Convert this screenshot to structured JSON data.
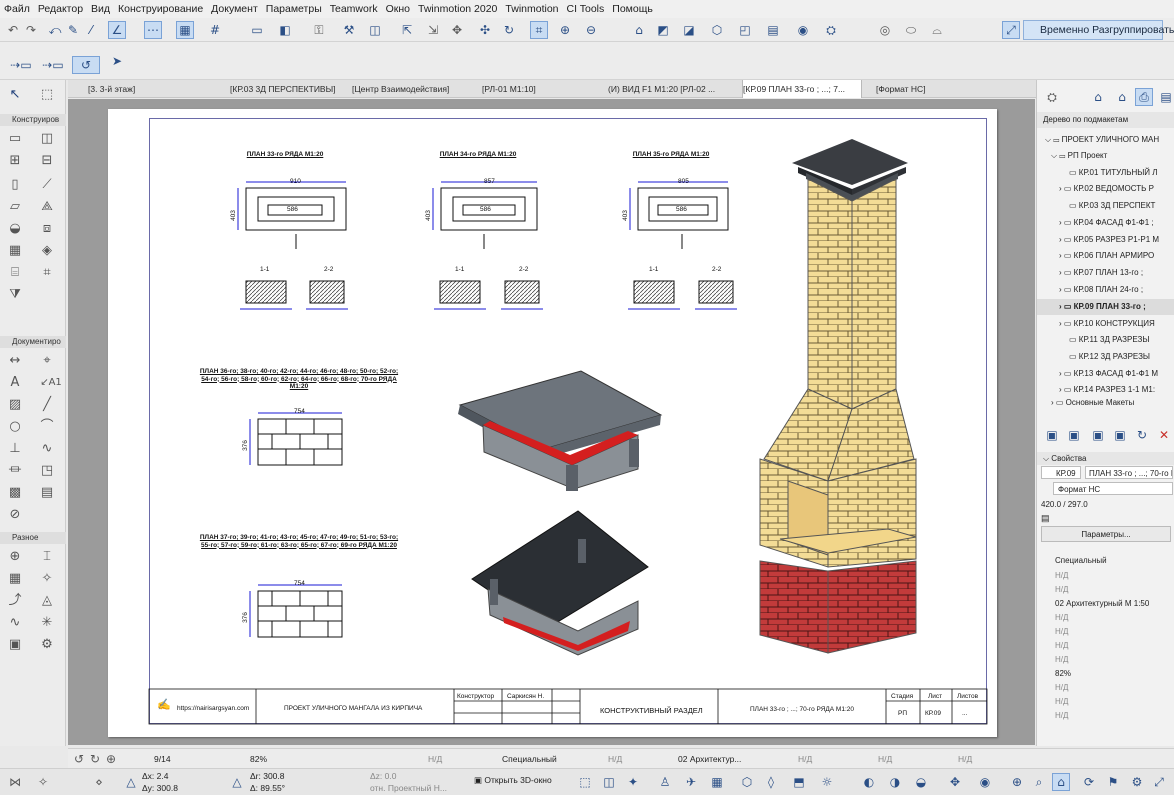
{
  "menu": [
    "Файл",
    "Редактор",
    "Вид",
    "Конструирование",
    "Документ",
    "Параметры",
    "Teamwork",
    "Окно",
    "Twinmotion 2020",
    "Twinmotion",
    "CI Tools",
    "Помощь"
  ],
  "toolbar": {
    "regroup_label": "Временно Разгруппировать"
  },
  "tabs": [
    "[3. 3-й этаж]",
    "[КР.03 3Д ПЕРСПЕКТИВЫ]",
    "[Центр Взаимодействия]",
    "[РЛ-01 М1:10]",
    "(И) ВИД F1 М1:20 [РЛ-02 ...",
    "[КР.09 ПЛАН 33-го ; ...; 7...",
    "[Формат НС]"
  ],
  "toolbox": {
    "sections": [
      "Конструиров",
      "Документиро",
      "Разное"
    ]
  },
  "drawing": {
    "plans": [
      {
        "title": "ПЛАН 33-го РЯДА М1:20",
        "dim": "910",
        "dim2": "586",
        "side": "403"
      },
      {
        "title": "ПЛАН 34-го РЯДА М1:20",
        "dim": "857",
        "dim2": "586",
        "side": "403"
      },
      {
        "title": "ПЛАН 35-го РЯДА М1:20",
        "dim": "805",
        "dim2": "586",
        "side": "403"
      }
    ],
    "section_labels": [
      "1-1",
      "2-2"
    ],
    "plan_mid": {
      "title": "ПЛАН 36-го; 38-го; 40-го; 42-го; 44-го; 46-го; 48-го; 50-го; 52-го; 54-го; 56-го; 58-го; 60-го; 62-го; 64-го; 66-го; 68-го; 70-го РЯДА М1:20",
      "dim": "754",
      "side": "376"
    },
    "plan_low": {
      "title": "ПЛАН 37-го; 39-го; 41-го; 43-го; 45-го; 47-го; 49-го; 51-го; 53-го; 55-го; 57-го; 59-го; 61-го; 63-го; 65-го; 67-го; 69-го РЯДА М1:20",
      "dim": "754",
      "side": "376"
    },
    "title_block": {
      "site": "https://nairisargsyan.com",
      "project": "ПРОЕКТ УЛИЧНОГО МАНГАЛА ИЗ КИРПИЧА",
      "role": "Конструктор",
      "person": "Саркисян Н.",
      "section": "КОНСТРУКТИВНЫЙ РАЗДЕЛ",
      "sheet_title": "ПЛАН 33-го ; ...; 70-го РЯДА М1:20",
      "h_stage": "Стадия",
      "h_sheet": "Лист",
      "h_sheets": "Листов",
      "stage": "РП",
      "sheet": "КР.09",
      "sheets": "..."
    }
  },
  "navigator": {
    "header": "Дерево по подмакетам",
    "root": "ПРОЕКТ УЛИЧНОГО МАН",
    "group": "РП Проект",
    "items": [
      "КР.01 ТИТУЛЬНЫЙ Л",
      "КР.02 ВЕДОМОСТЬ Р",
      "КР.03 3Д ПЕРСПЕКТ",
      "КР.04 ФАСАД Ф1-Ф1 ;",
      "КР.05 РАЗРЕЗ Р1-Р1 М",
      "КР.06 ПЛАН АРМИРО",
      "КР.07 ПЛАН 13-го ;",
      "КР.08 ПЛАН 24-го ;",
      "КР.09 ПЛАН 33-го ;",
      "КР.10 КОНСТРУКЦИЯ",
      "КР.11 3Д РАЗРЕЗЫ",
      "КР.12 3Д РАЗРЕЗЫ",
      "КР.13 ФАСАД Ф1-Ф1 М",
      "КР.14 РАЗРЕЗ 1-1 М1:"
    ],
    "cut_item": "Основные Макеты"
  },
  "props": {
    "header": "Свойства",
    "id": "КР.09",
    "name": "ПЛАН 33-го ; ...; 70-го РЯДА М1:20",
    "format": "Формат НС",
    "size": "420.0 / 297.0",
    "params_button": "Параметры...",
    "special": "Специальный",
    "nd": "Н/Д",
    "scale": "02 Архитектурный М 1:50",
    "zoom": "82%"
  },
  "status": {
    "page": "9/14",
    "zoom": "82%",
    "nd": "Н/Д",
    "layer": "Специальный",
    "scale": "02 Архитектур...",
    "dx": "Δx: 2.4",
    "dy": "Δy: 300.8",
    "dr": "Δr: 300.8",
    "da": "Δ: 89.55°",
    "dz": "Δz: 0.0",
    "ref": "отн. Проектный Н...",
    "open3d": "Открыть 3D-окно"
  }
}
